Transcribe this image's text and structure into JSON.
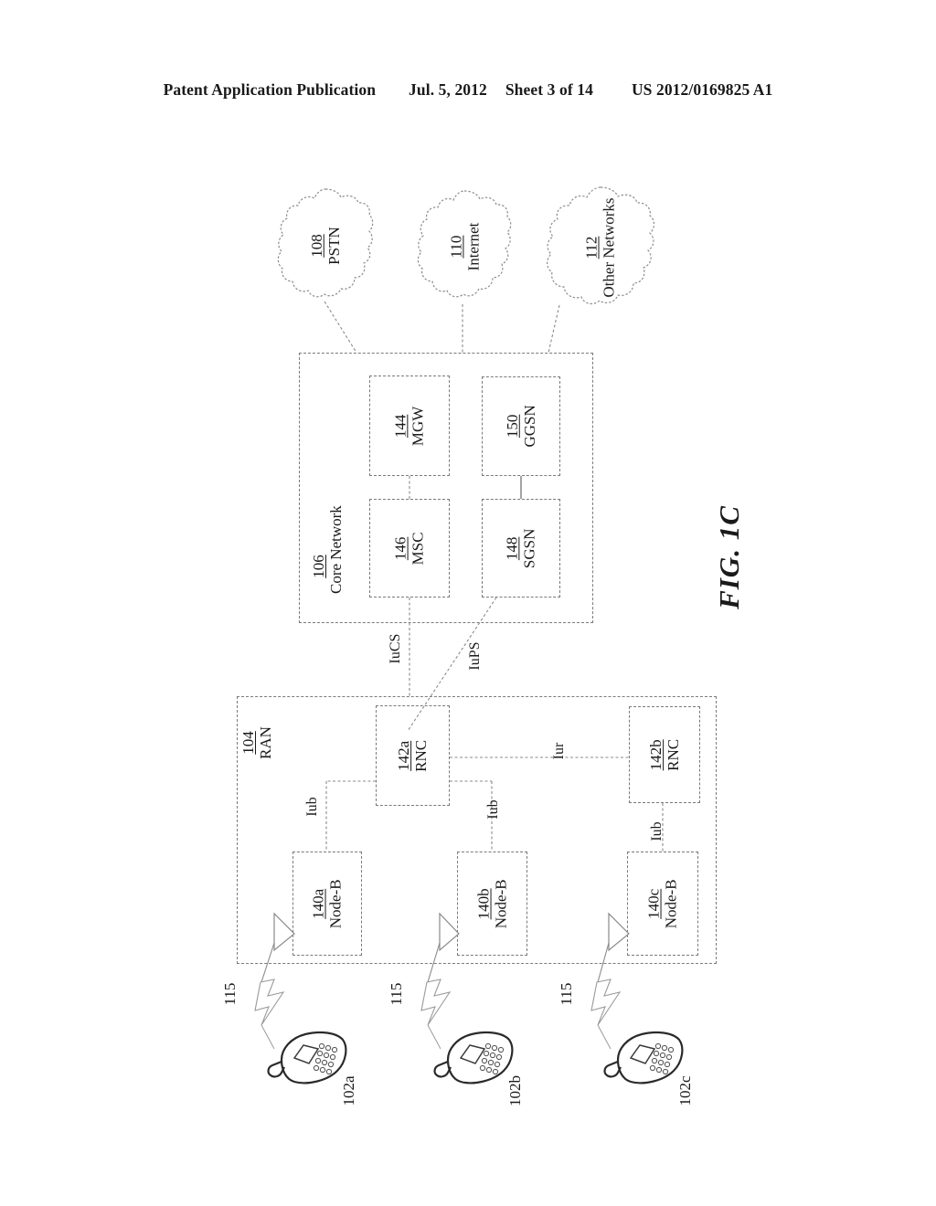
{
  "header": {
    "publication": "Patent Application Publication",
    "date": "Jul. 5, 2012",
    "sheet": "Sheet 3 of 14",
    "docnum": "US 2012/0169825 A1"
  },
  "figure": {
    "label": "FIG. 1C"
  },
  "clouds": [
    {
      "ref": "108",
      "name": "PSTN"
    },
    {
      "ref": "110",
      "name": "Internet"
    },
    {
      "ref": "112",
      "name": "Other Networks"
    }
  ],
  "core_network": {
    "ref": "106",
    "name": "Core Network",
    "nodes": [
      {
        "ref": "144",
        "name": "MGW"
      },
      {
        "ref": "150",
        "name": "GGSN"
      },
      {
        "ref": "146",
        "name": "MSC"
      },
      {
        "ref": "148",
        "name": "SGSN"
      }
    ]
  },
  "ran": {
    "ref": "104",
    "name": "RAN",
    "rncs": [
      {
        "ref": "142a",
        "name": "RNC"
      },
      {
        "ref": "142b",
        "name": "RNC"
      }
    ],
    "nodebs": [
      {
        "ref": "140a",
        "name": "Node-B"
      },
      {
        "ref": "140b",
        "name": "Node-B"
      },
      {
        "ref": "140c",
        "name": "Node-B"
      }
    ]
  },
  "interfaces": {
    "iucs": "IuCS",
    "iups": "IuPS",
    "iur": "Iur",
    "iub_a": "Iub",
    "iub_b": "Iub",
    "iub_c": "Iub"
  },
  "wtrus": [
    {
      "ref": "102a",
      "air": "115"
    },
    {
      "ref": "102b",
      "air": "115"
    },
    {
      "ref": "102c",
      "air": "115"
    }
  ],
  "colors": {
    "ink": "#1a1a1a",
    "line": "#7a7a7a",
    "line_solid": "#5a5a5a",
    "background": "#ffffff"
  }
}
